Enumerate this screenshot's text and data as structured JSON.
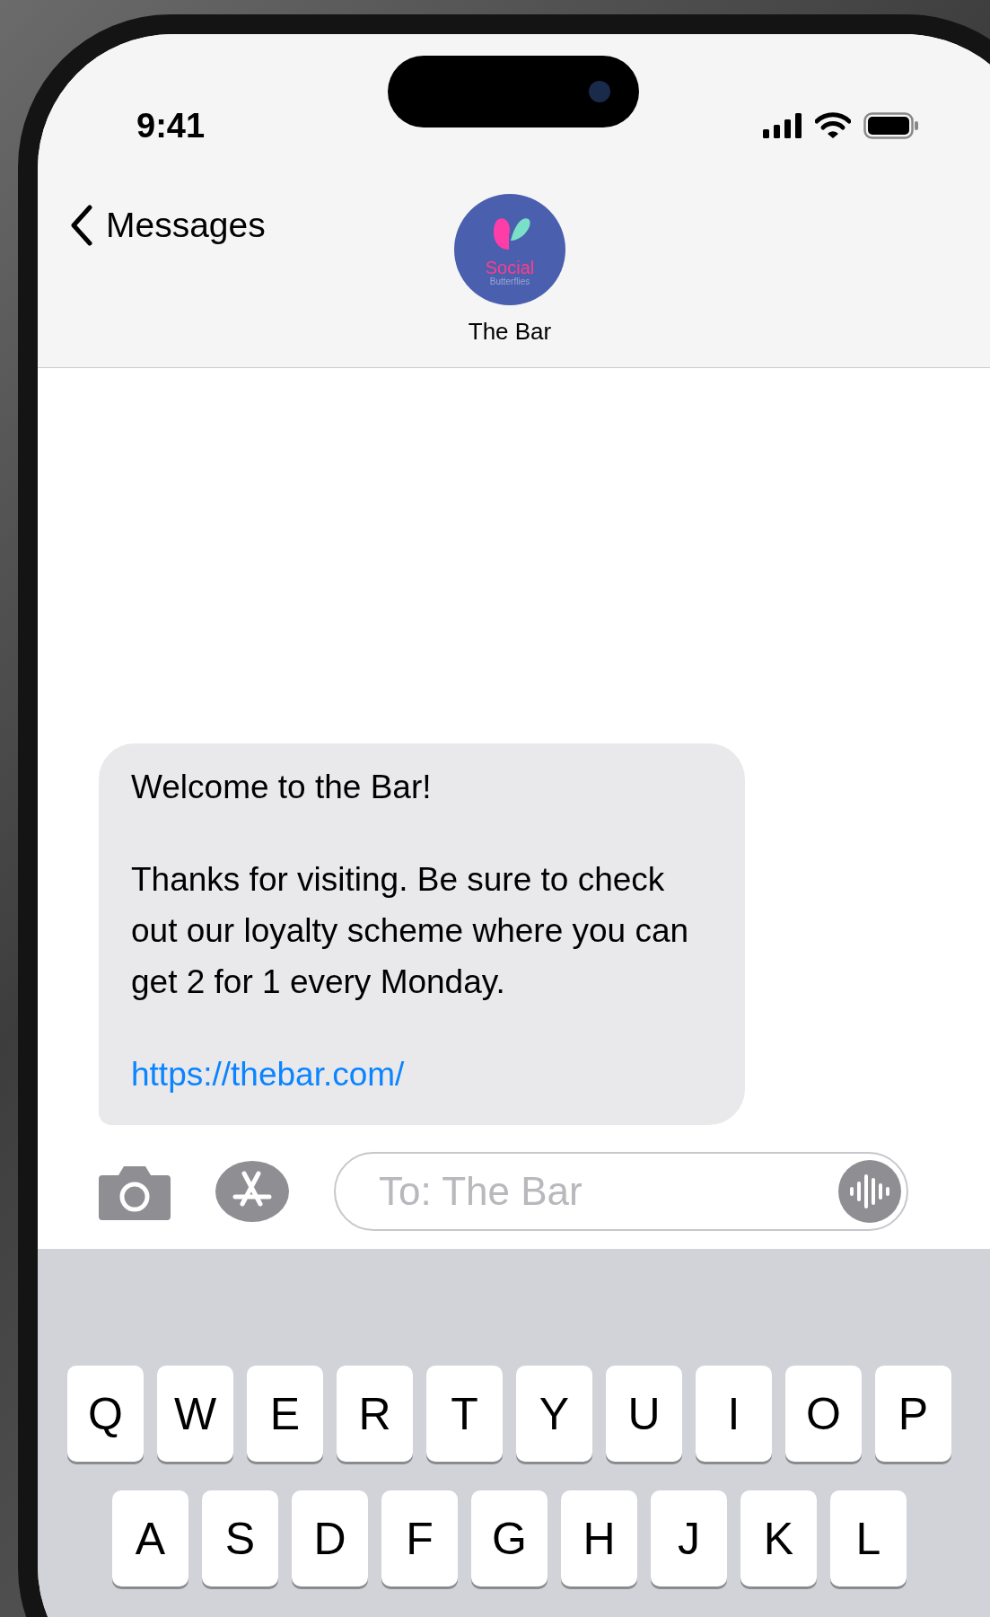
{
  "status_bar": {
    "time": "9:41"
  },
  "nav": {
    "back_label": "Messages",
    "contact_name": "The Bar",
    "avatar": {
      "title": "Social",
      "subtitle": "Butterflies"
    }
  },
  "message": {
    "paragraphs": [
      "Welcome to the Bar!",
      "Thanks for visiting. Be sure to check out our loyalty scheme where you can get 2 for 1 every Monday."
    ],
    "link": "https://thebar.com/"
  },
  "composer": {
    "placeholder": "To: The Bar"
  },
  "keyboard": {
    "rows": [
      [
        "Q",
        "W",
        "E",
        "R",
        "T",
        "Y",
        "U",
        "I",
        "O",
        "P"
      ],
      [
        "A",
        "S",
        "D",
        "F",
        "G",
        "H",
        "J",
        "K",
        "L"
      ]
    ]
  }
}
